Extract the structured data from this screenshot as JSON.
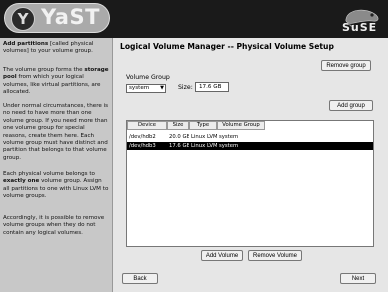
{
  "header": {
    "logo_text": "YaST",
    "logo_symbol": "Y",
    "brand": "SuSE"
  },
  "help": {
    "p1_bold": "Add partitions",
    "p1_rest": " [called physical volumes] to your volume group.",
    "p2_a": "The volume group forms the ",
    "p2_bold": "storage pool",
    "p2_b": " from which your logical volumes, like virtual partitions, are allocated.",
    "p3": "Under normal circumstances, there is no need to have more than one volume group. If you need more than one volume group for special reasons, create them here. Each volume group must have distinct and partition that belongs to that volume group.",
    "p4_a": "Each physical volume belongs to ",
    "p4_bold": "exactly one",
    "p4_b": " volume group. Assign all partitions to one with Linux LVM to volume groups.",
    "p5": "Accordingly, it is possible to remove volume groups when they do not contain any logical volumes."
  },
  "main": {
    "title": "Logical Volume Manager -- Physical Volume Setup",
    "remove_group": "Remove group",
    "volume_group_label": "Volume Group",
    "volume_group_value": "system",
    "size_label": "Size:",
    "size_value": "17.6 GB",
    "add_group": "Add group",
    "columns": [
      "Device",
      "Size",
      "Type",
      "Volume Group"
    ],
    "rows": [
      {
        "device": "/dev/hdb2",
        "size": "20.0 GB",
        "type": "Linux LVM",
        "group": "system"
      },
      {
        "device": "/dev/hdb3",
        "size": "17.6 GB",
        "type": "Linux LVM",
        "group": "system"
      }
    ],
    "add_volume": "Add Volume",
    "remove_volume": "Remove Volume",
    "back": "Back",
    "next": "Next"
  },
  "colors": {
    "header_bg": "#1a1a1a",
    "help_bg": "#c8c8c8",
    "selection_bg": "#000000"
  }
}
